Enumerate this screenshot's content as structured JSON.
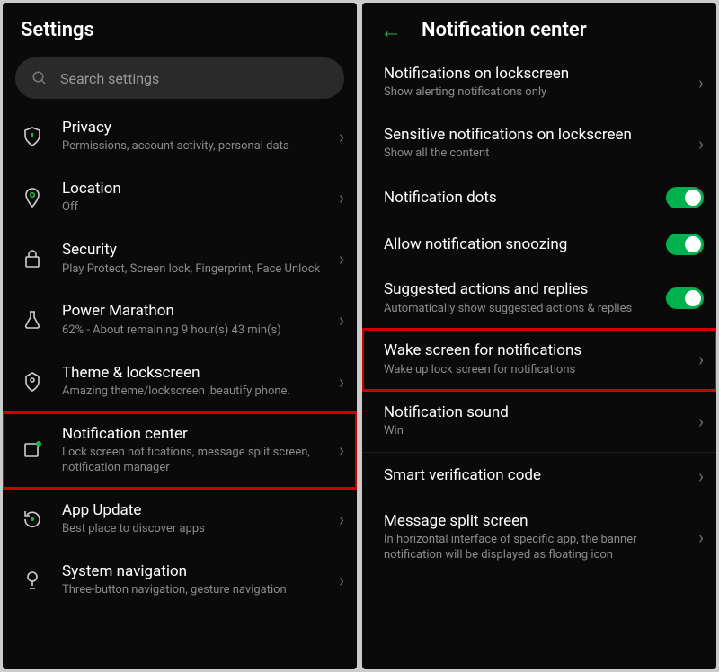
{
  "left": {
    "title": "Settings",
    "search_placeholder": "Search settings",
    "items": [
      {
        "title": "Privacy",
        "sub": "Permissions, account activity, personal data"
      },
      {
        "title": "Location",
        "sub": "Off"
      },
      {
        "title": "Security",
        "sub": "Play Protect, Screen lock, Fingerprint, Face Unlock"
      },
      {
        "title": "Power Marathon",
        "sub": "62% - About remaining 9 hour(s)  43 min(s)"
      },
      {
        "title": "Theme & lockscreen",
        "sub": "Amazing theme/lockscreen ,beautify phone."
      },
      {
        "title": "Notification center",
        "sub": "Lock screen notifications, message split screen, notification manager"
      },
      {
        "title": "App Update",
        "sub": "Best place to discover apps"
      },
      {
        "title": "System navigation",
        "sub": "Three-button navigation, gesture navigation"
      }
    ]
  },
  "right": {
    "title": "Notification center",
    "items": [
      {
        "title": "Notifications on lockscreen",
        "sub": "Show alerting notifications only",
        "kind": "chev"
      },
      {
        "title": "Sensitive notifications on lockscreen",
        "sub": "Show all the content",
        "kind": "chev"
      },
      {
        "title": "Notification dots",
        "sub": "",
        "kind": "toggle"
      },
      {
        "title": "Allow notification snoozing",
        "sub": "",
        "kind": "toggle"
      },
      {
        "title": "Suggested actions and replies",
        "sub": "Automatically show suggested actions & replies",
        "kind": "toggle"
      },
      {
        "title": "Wake screen for notifications",
        "sub": "Wake up lock screen for notifications",
        "kind": "chev"
      },
      {
        "title": "Notification sound",
        "sub": "Win",
        "kind": "chev"
      },
      {
        "title": "Smart verification code",
        "sub": "",
        "kind": "chev"
      },
      {
        "title": "Message split screen",
        "sub": "In horizontal interface of specific app, the banner notification will be displayed as floating icon",
        "kind": "chev"
      }
    ]
  }
}
